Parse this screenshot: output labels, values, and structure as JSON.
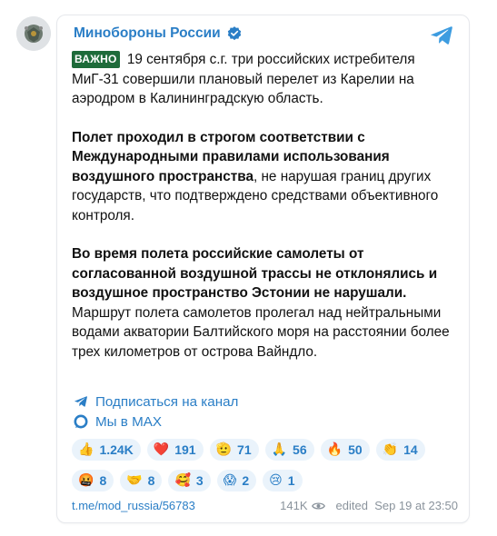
{
  "channel": {
    "name": "Минобороны России",
    "verified": true
  },
  "post": {
    "badge": "ВАЖНО",
    "p1_rest": " 19 сентября с.г. три российских истребителя МиГ-31 совершили плановый перелет из Карелии на аэродром в Калининградскую область.",
    "p2_bold": "Полет проходил в строгом соответствии с Международными правилами использования воздушного пространства",
    "p2_rest": ", не нарушая границ других государств, что подтверждено средствами объективного контроля.",
    "p3_bold": "Во время полета российские самолеты от согласованной воздушной трассы не отклонялись и воздушное пространство Эстонии не нарушали.",
    "p3_rest": " Маршрут полета самолетов пролегал над нейтральными водами акватории Балтийского моря на расстоянии более трех километров от острова Вайндло."
  },
  "links": [
    {
      "label": "Подписаться на канал",
      "icon": "telegram-plane-icon"
    },
    {
      "label": "Мы в MAX",
      "icon": "max-icon"
    }
  ],
  "reactions": [
    [
      {
        "emoji": "👍",
        "count": "1.24K"
      },
      {
        "emoji": "❤️",
        "count": "191"
      },
      {
        "emoji": "🫡",
        "count": "71"
      },
      {
        "emoji": "🙏",
        "count": "56"
      },
      {
        "emoji": "🔥",
        "count": "50"
      },
      {
        "emoji": "👏",
        "count": "14"
      }
    ],
    [
      {
        "emoji": "🤬",
        "count": "8"
      },
      {
        "emoji": "🤝",
        "count": "8"
      },
      {
        "emoji": "🥰",
        "count": "3"
      },
      {
        "emoji": "😱",
        "count": "2"
      },
      {
        "emoji": "😢",
        "count": "1"
      }
    ]
  ],
  "footer": {
    "post_link": "t.me/mod_russia/56783",
    "views": "141K",
    "edited": "edited  Sep 19 at 23:50"
  },
  "colors": {
    "link": "#2a7ec6",
    "badge": "#1e6b3a",
    "reaction_bg": "#eaf3fb"
  }
}
